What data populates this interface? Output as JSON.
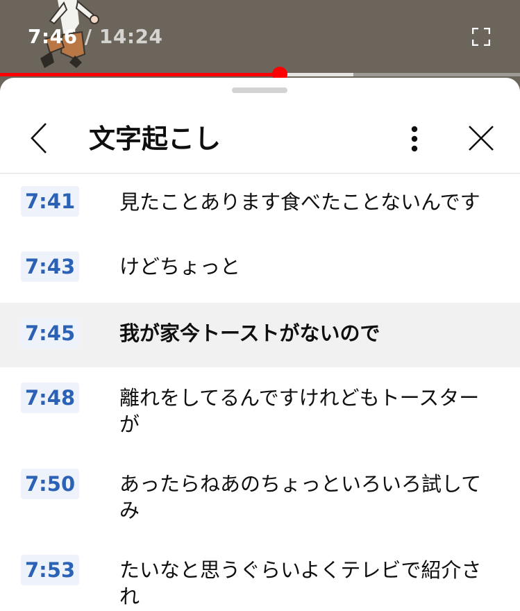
{
  "player": {
    "current_time": "7:46",
    "separator": "/",
    "duration": "14:24",
    "progress_fraction": 0.538,
    "buffer_fraction": 0.68,
    "fullscreen_icon": "fullscreen-icon"
  },
  "panel": {
    "title": "文字起こし",
    "back_icon": "chevron-left-icon",
    "more_icon": "more-vertical-icon",
    "close_icon": "close-icon"
  },
  "colors": {
    "progress": "#ff0000",
    "timestamp_text": "#2b62b5",
    "timestamp_bg": "#eef3fb",
    "active_row_bg": "#f1f1f1"
  },
  "transcript": [
    {
      "time": "7:41",
      "text": "見たことあります食べたことないんです",
      "active": false
    },
    {
      "time": "7:43",
      "text": "けどちょっと",
      "active": false
    },
    {
      "time": "7:45",
      "text": "我が家今トーストがないので",
      "active": true
    },
    {
      "time": "7:48",
      "text": "離れをしてるんですけれどもトースターが",
      "active": false
    },
    {
      "time": "7:50",
      "text": "あったらねあのちょっといろいろ試してみ",
      "active": false
    },
    {
      "time": "7:53",
      "text": "たいなと思うぐらいよくテレビで紹介され",
      "active": false
    }
  ]
}
